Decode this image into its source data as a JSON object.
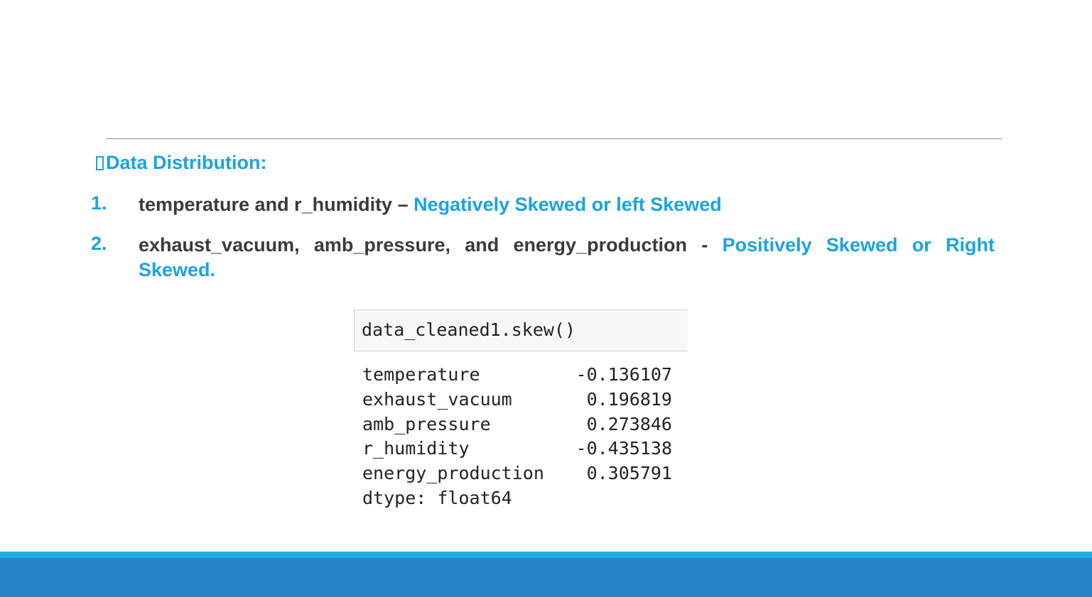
{
  "heading": "Data Distribution:",
  "items": [
    {
      "number": "1.",
      "text": "temperature and r_humidity – ",
      "highlight": "Negatively Skewed or left Skewed"
    },
    {
      "number": "2.",
      "text": "exhaust_vacuum, amb_pressure, and energy_production - ",
      "highlight": "Positively Skewed or Right Skewed."
    }
  ],
  "code": {
    "input": "data_cleaned1.skew()",
    "rows": [
      {
        "name": "temperature",
        "value": "-0.136107"
      },
      {
        "name": "exhaust_vacuum",
        "value": "0.196819"
      },
      {
        "name": "amb_pressure",
        "value": "0.273846"
      },
      {
        "name": "r_humidity",
        "value": "-0.435138"
      },
      {
        "name": "energy_production",
        "value": "0.305791"
      }
    ],
    "dtype": "dtype: float64"
  },
  "colors": {
    "accent": "#1BA3E0",
    "footer_light": "#1EAEE3",
    "footer_dark": "#2683C6"
  }
}
